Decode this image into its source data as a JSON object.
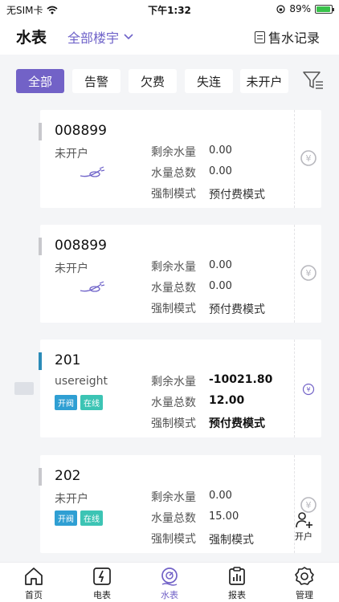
{
  "status_bar": {
    "carrier": "无SIM卡",
    "time": "下午1:32",
    "battery": "89%"
  },
  "header": {
    "title": "水表",
    "building": "全部楼宇",
    "records": "售水记录"
  },
  "filters": [
    "全部",
    "告警",
    "欠费",
    "失连",
    "未开户"
  ],
  "labels": {
    "remaining": "剩余水量",
    "total": "水量总数",
    "mode": "强制模式"
  },
  "badges": {
    "open": "开阀",
    "online": "在线"
  },
  "cards": [
    {
      "number": "008899",
      "user": "未开户",
      "remaining": "0.00",
      "total": "0.00",
      "mode": "预付费模式"
    },
    {
      "number": "008899",
      "user": "未开户",
      "remaining": "0.00",
      "total": "0.00",
      "mode": "预付费模式"
    },
    {
      "number": "201",
      "user": "usereight",
      "remaining": "-10021.80",
      "total": "12.00",
      "mode": "预付费模式"
    },
    {
      "number": "202",
      "user": "未开户",
      "remaining": "0.00",
      "total": "15.00",
      "mode": "强制模式"
    }
  ],
  "floating_action": {
    "label": "开户",
    "icon": "add-user-icon"
  },
  "nav": [
    {
      "label": "首页",
      "icon": "home-icon"
    },
    {
      "label": "电表",
      "icon": "electric-meter-icon"
    },
    {
      "label": "水表",
      "icon": "water-meter-icon"
    },
    {
      "label": "报表",
      "icon": "report-icon"
    },
    {
      "label": "管理",
      "icon": "gear-icon"
    }
  ],
  "colors": {
    "accent": "#7262c7",
    "open_badge": "#2f9fd3",
    "online_badge": "#3cc4b4",
    "card_accent_active": "#2b8bb8"
  }
}
